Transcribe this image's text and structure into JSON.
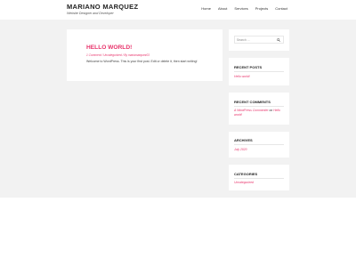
{
  "site": {
    "title": "MARIANO MARQUEZ",
    "tagline": "Website Designer and Developer"
  },
  "nav": {
    "items": [
      "Home",
      "About",
      "Services",
      "Projects",
      "Contact"
    ]
  },
  "post": {
    "title": "HELLO WORLD!",
    "meta": "1 Comment / Uncategorized / By mariamarquez03",
    "excerpt": "Welcome to WordPress. This is your first post. Edit or delete it, then start writing!"
  },
  "sidebar": {
    "search_placeholder": "Search ...",
    "recent_posts": {
      "title": "RECENT POSTS",
      "items": [
        "Hello world!"
      ]
    },
    "recent_comments": {
      "title": "RECENT COMMENTS",
      "author": "A WordPress Commenter",
      "connector": "on",
      "post": "Hello world!"
    },
    "archives": {
      "title": "ARCHIVES",
      "items": [
        "July 2020"
      ]
    },
    "categories": {
      "title": "CATEGORIES",
      "items": [
        "Uncategorized"
      ]
    }
  },
  "colors": {
    "accent": "#e8336b",
    "page_background": "#f2f2f2",
    "card_background": "#ffffff"
  }
}
